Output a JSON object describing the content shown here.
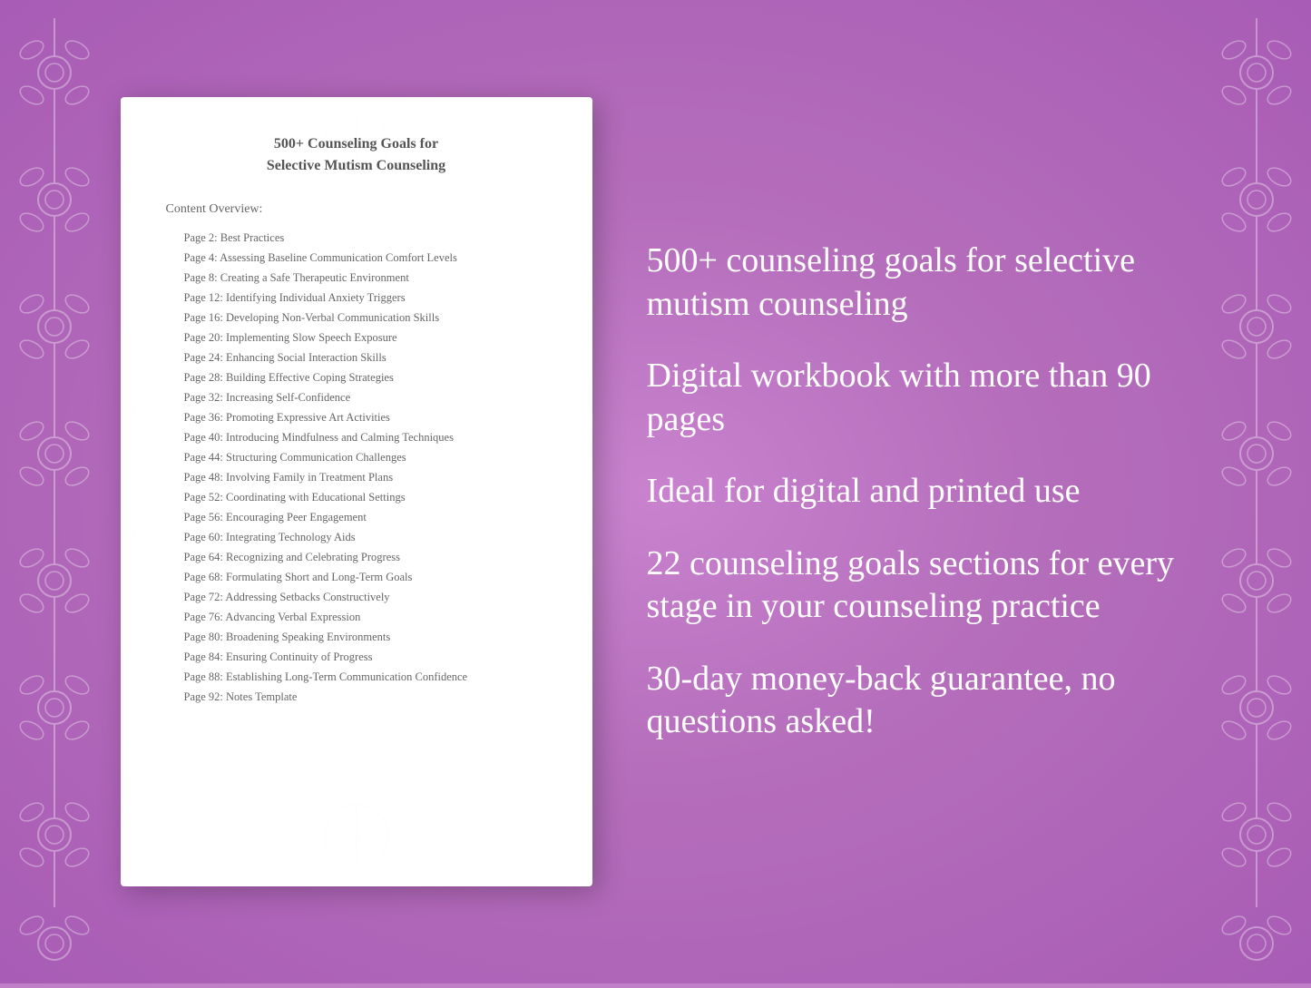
{
  "background": {
    "color": "#c17fc8"
  },
  "document": {
    "title_line1": "500+ Counseling Goals for",
    "title_line2": "Selective Mutism Counseling",
    "content_overview_label": "Content Overview:",
    "toc_items": [
      {
        "page": "Page  2:",
        "title": "Best Practices"
      },
      {
        "page": "Page  4:",
        "title": "Assessing Baseline Communication Comfort Levels"
      },
      {
        "page": "Page  8:",
        "title": "Creating a Safe Therapeutic Environment"
      },
      {
        "page": "Page 12:",
        "title": "Identifying Individual Anxiety Triggers"
      },
      {
        "page": "Page 16:",
        "title": "Developing Non-Verbal Communication Skills"
      },
      {
        "page": "Page 20:",
        "title": "Implementing Slow Speech Exposure"
      },
      {
        "page": "Page 24:",
        "title": "Enhancing Social Interaction Skills"
      },
      {
        "page": "Page 28:",
        "title": "Building Effective Coping Strategies"
      },
      {
        "page": "Page 32:",
        "title": "Increasing Self-Confidence"
      },
      {
        "page": "Page 36:",
        "title": "Promoting Expressive Art Activities"
      },
      {
        "page": "Page 40:",
        "title": "Introducing Mindfulness and Calming Techniques"
      },
      {
        "page": "Page 44:",
        "title": "Structuring Communication Challenges"
      },
      {
        "page": "Page 48:",
        "title": "Involving Family in Treatment Plans"
      },
      {
        "page": "Page 52:",
        "title": "Coordinating with Educational Settings"
      },
      {
        "page": "Page 56:",
        "title": "Encouraging Peer Engagement"
      },
      {
        "page": "Page 60:",
        "title": "Integrating Technology Aids"
      },
      {
        "page": "Page 64:",
        "title": "Recognizing and Celebrating Progress"
      },
      {
        "page": "Page 68:",
        "title": "Formulating Short and Long-Term Goals"
      },
      {
        "page": "Page 72:",
        "title": "Addressing Setbacks Constructively"
      },
      {
        "page": "Page 76:",
        "title": "Advancing Verbal Expression"
      },
      {
        "page": "Page 80:",
        "title": "Broadening Speaking Environments"
      },
      {
        "page": "Page 84:",
        "title": "Ensuring Continuity of Progress"
      },
      {
        "page": "Page 88:",
        "title": "Establishing Long-Term Communication Confidence"
      },
      {
        "page": "Page 92:",
        "title": "Notes Template"
      }
    ]
  },
  "features": [
    "500+ counseling goals for selective mutism counseling",
    "Digital workbook with more than 90 pages",
    "Ideal for digital and printed use",
    "22 counseling goals sections for every stage in your counseling practice",
    "30-day money-back guarantee, no questions asked!"
  ]
}
